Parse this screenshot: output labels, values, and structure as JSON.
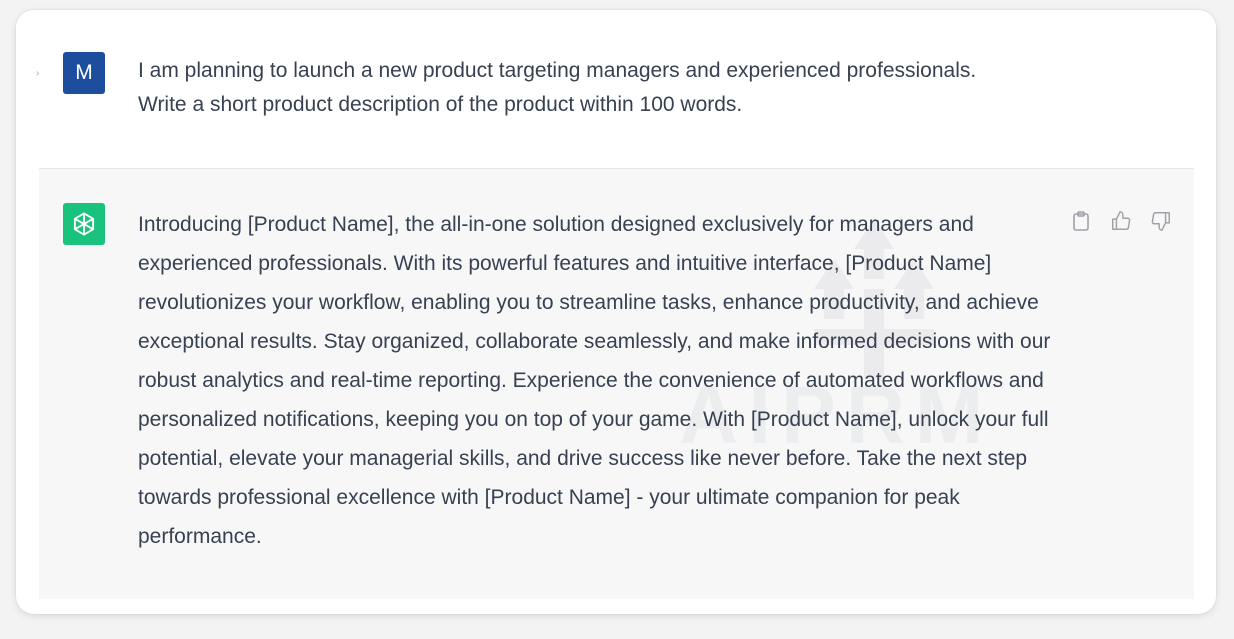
{
  "conversation": {
    "user": {
      "avatar_letter": "M",
      "avatar_color": "#1d4e9e",
      "message": "I am planning to launch a new product targeting managers and experienced professionals.\nWrite a short product description of the product within 100 words."
    },
    "assistant": {
      "avatar_icon": "openai-logo-icon",
      "avatar_color": "#19c37d",
      "message": "Introducing [Product Name], the all-in-one solution designed exclusively for managers and experienced professionals. With its powerful features and intuitive interface, [Product Name] revolutionizes your workflow, enabling you to streamline tasks, enhance productivity, and achieve exceptional results. Stay organized, collaborate seamlessly, and make informed decisions with our robust analytics and real-time reporting. Experience the convenience of automated workflows and personalized notifications, keeping you on top of your game. With [Product Name], unlock your full potential, elevate your managerial skills, and drive success like never before. Take the next step towards professional excellence with [Product Name] - your ultimate companion for peak performance.",
      "actions": [
        {
          "name": "copy",
          "icon": "clipboard-icon"
        },
        {
          "name": "thumbs-up",
          "icon": "thumbs-up-icon"
        },
        {
          "name": "thumbs-down",
          "icon": "thumbs-down-icon"
        }
      ]
    }
  },
  "watermark": {
    "text": "AIPRM"
  }
}
